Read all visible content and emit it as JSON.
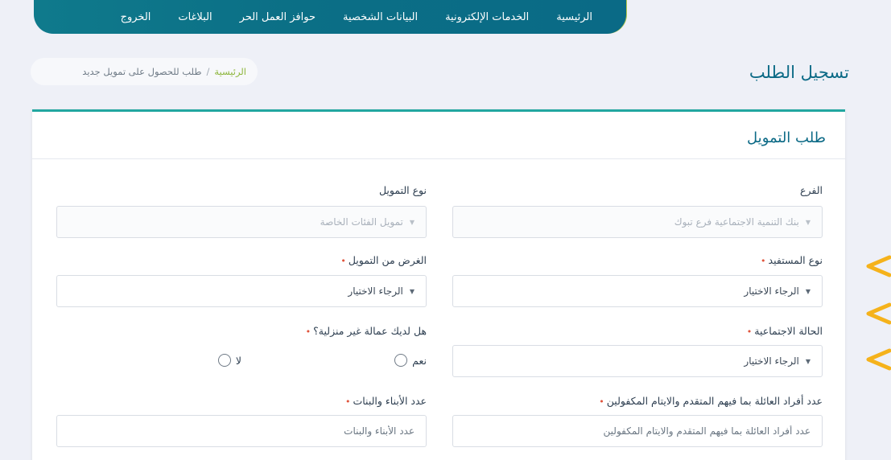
{
  "nav": {
    "items": [
      {
        "label": "الرئيسية"
      },
      {
        "label": "الخدمات الإلكترونية"
      },
      {
        "label": "البيانات الشخصية"
      },
      {
        "label": "حوافز العمل الحر"
      },
      {
        "label": "البلاغات"
      },
      {
        "label": "الخروج"
      }
    ]
  },
  "header": {
    "title": "تسجيل الطلب",
    "breadcrumb": {
      "home": "الرئيسية",
      "separator": "/",
      "current": "طلب للحصول على تمويل جديد"
    }
  },
  "form": {
    "title": "طلب التمويل",
    "branch": {
      "label": "الفرع",
      "value": "بنك التنمية الاجتماعية فرع تبوك"
    },
    "funding_type": {
      "label": "نوع التمويل",
      "value": "تمويل الفئات الخاصة"
    },
    "beneficiary_type": {
      "label": "نوع المستفيد",
      "required_mark": "•",
      "value": "الرجاء الاختيار"
    },
    "funding_purpose": {
      "label": "الغرض من التمويل",
      "required_mark": "•",
      "value": "الرجاء الاختيار"
    },
    "social_status": {
      "label": "الحالة الاجتماعية",
      "required_mark": "•",
      "value": "الرجاء الاختيار"
    },
    "domestic_workers": {
      "label": "هل لديك عمالة غير منزلية؟",
      "required_mark": "•",
      "option_yes": "نعم",
      "option_no": "لا"
    },
    "family_members": {
      "label": "عدد أفراد العائلة بما فيهم المتقدم والايتام المكفولين",
      "required_mark": "•",
      "placeholder": "عدد أفراد العائلة بما فيهم المتقدم والايتام المكفولين"
    },
    "children_count": {
      "label": "عدد الأبناء والبنات",
      "required_mark": "•",
      "placeholder": "عدد الأبناء والبنات"
    }
  },
  "colors": {
    "nav_bg": "#0b6f86",
    "accent": "#22a7a0",
    "title": "#0c6a86",
    "required": "#e0553d",
    "arrow": "#f5b21b"
  }
}
